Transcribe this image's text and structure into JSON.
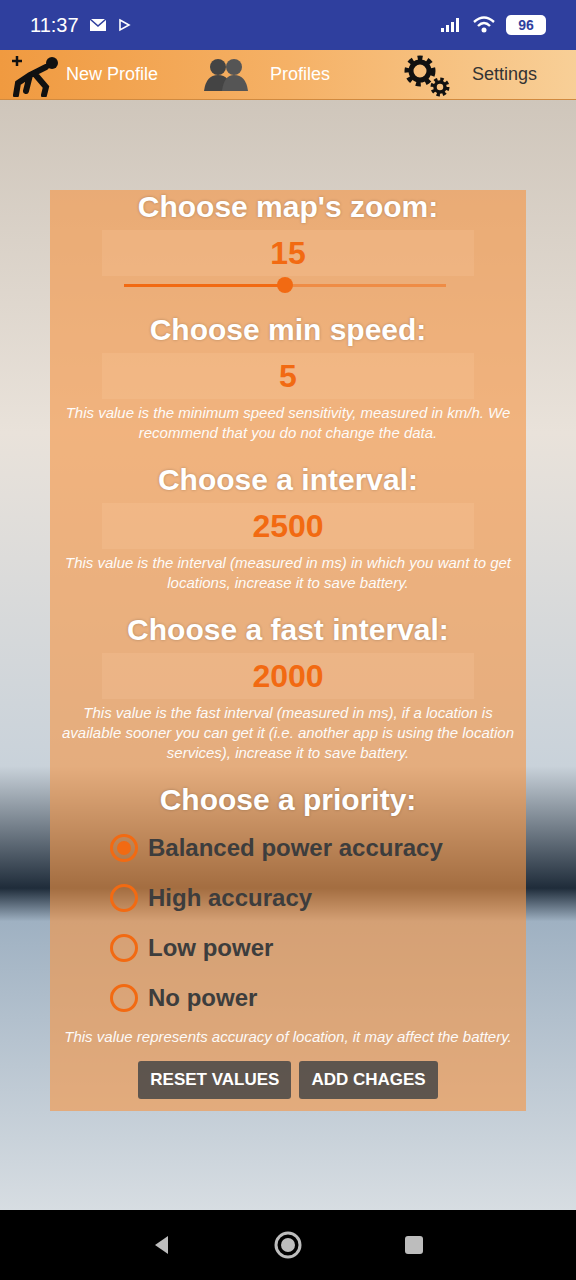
{
  "status_bar": {
    "time": "11:37",
    "battery": "96"
  },
  "top_bar": {
    "items": [
      {
        "label": "New Profile",
        "selected": false
      },
      {
        "label": "Profiles",
        "selected": false
      },
      {
        "label": "Settings",
        "selected": true
      }
    ]
  },
  "settings": {
    "fields": [
      {
        "kind": "slider",
        "title": "Choose map's zoom:",
        "value": "15",
        "level": 0.5,
        "hint": ""
      },
      {
        "kind": "number",
        "title": "Choose min speed:",
        "value": "5",
        "level": 0,
        "hint": "This value is the minimum speed sensitivity, measured in km/h. We recommend that you do not change the data."
      },
      {
        "kind": "number",
        "title": "Choose a interval:",
        "value": "2500",
        "level": 0,
        "hint": "This value is the interval (measured in ms) in which you want to get locations, increase it to save battery."
      },
      {
        "kind": "number",
        "title": "Choose a fast interval:",
        "value": "2000",
        "level": 0,
        "hint": "This value is the fast interval (measured in ms), if a location is available sooner you can get it (i.e. another app is using the location services), increase it to save battery."
      }
    ],
    "priority": {
      "title": "Choose a priority:",
      "options": [
        {
          "label": "Balanced power accuracy",
          "selected": true
        },
        {
          "label": "High accuracy",
          "selected": false
        },
        {
          "label": "Low power",
          "selected": false
        },
        {
          "label": "No power",
          "selected": false
        }
      ],
      "hint": "This value represents accuracy of location, it may affect the battery."
    },
    "buttons": [
      "RESET VALUES",
      "ADD CHAGES"
    ]
  }
}
